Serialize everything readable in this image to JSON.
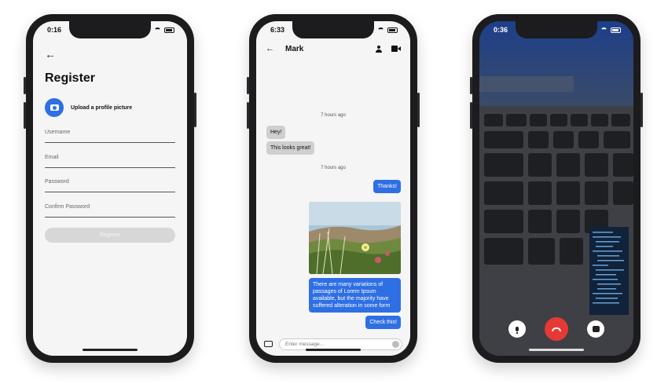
{
  "phone1": {
    "time": "0:16",
    "title": "Register",
    "upload_label": "Upload a profile picture",
    "fields": [
      {
        "label": "Username"
      },
      {
        "label": "Email"
      },
      {
        "label": "Password"
      },
      {
        "label": "Confirm Password"
      }
    ],
    "register_button": "Register"
  },
  "phone2": {
    "time": "6:33",
    "contact_name": "Mark",
    "timestamps": [
      "7 hours ago",
      "7 hours ago"
    ],
    "messages": [
      {
        "side": "in",
        "text": "Hey!"
      },
      {
        "side": "in",
        "text": "This looks great!"
      },
      {
        "side": "out",
        "text": "Thanks!"
      },
      {
        "side": "out",
        "text": "There are many variations of passages of Lorem Ipsum available, but the majority have suffered alteration in some form"
      },
      {
        "side": "out",
        "text": "Check this!"
      }
    ],
    "composer_placeholder": "Enter message..."
  },
  "phone3": {
    "time": "0:36"
  },
  "colors": {
    "accent": "#2f6fe4",
    "end_call": "#e53935",
    "disabled_button": "#d7d7d7"
  }
}
